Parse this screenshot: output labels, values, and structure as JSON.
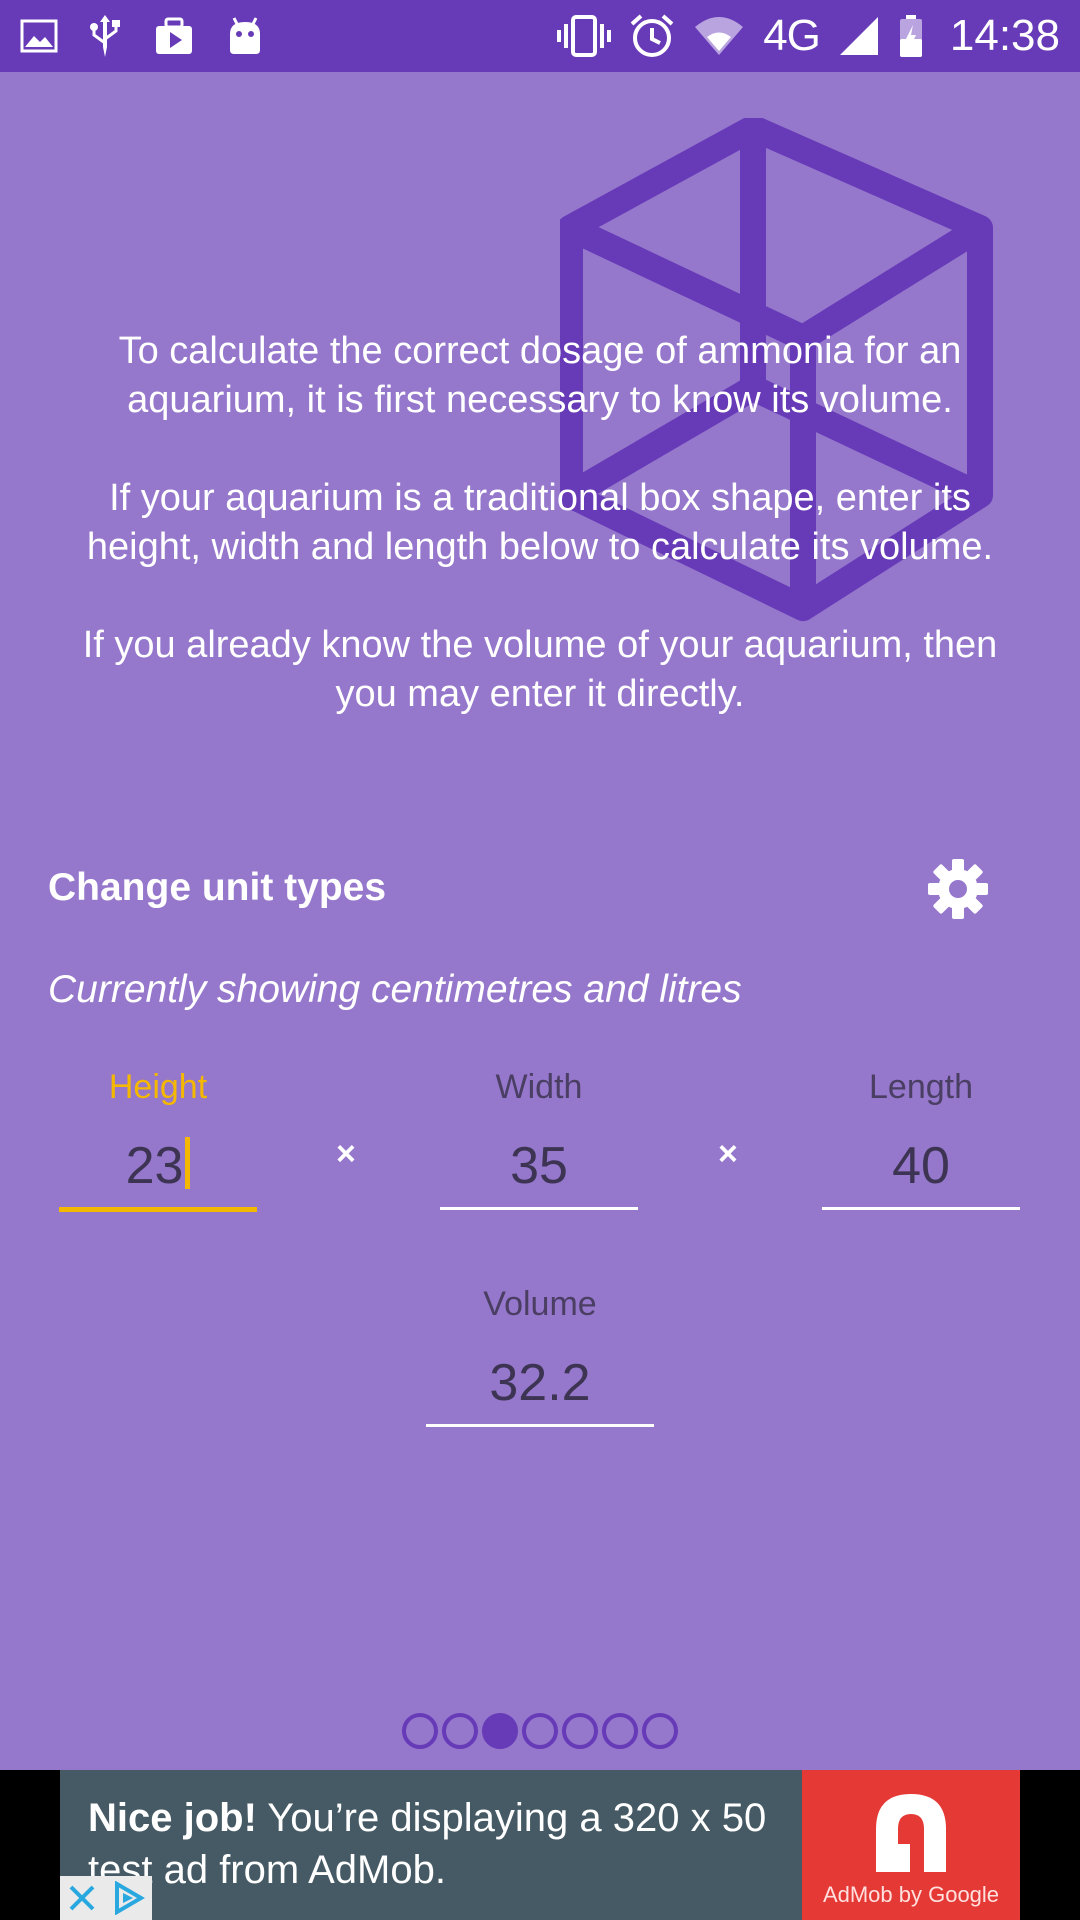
{
  "status_bar": {
    "network": "4G",
    "time": "14:38",
    "icons": [
      "image-icon",
      "usb-icon",
      "media-icon",
      "android-icon",
      "vibrate-icon",
      "alarm-icon",
      "wifi-icon",
      "signal-icon",
      "battery-icon"
    ]
  },
  "intro": {
    "paragraph1": "To calculate the correct dosage of ammonia for an aquarium, it is first necessary to know its volume.",
    "paragraph2": "If your aquarium is a traditional box shape, enter its height, width and length below to calculate its volume.",
    "paragraph3": "If you already know the volume of your aquarium, then you may enter it directly."
  },
  "units": {
    "title": "Change unit types",
    "description": "Currently showing centimetres and litres"
  },
  "dimensions": {
    "height_label": "Height",
    "height_value": "23",
    "width_label": "Width",
    "width_value": "35",
    "length_label": "Length",
    "length_value": "40",
    "times_symbol": "×"
  },
  "volume": {
    "label": "Volume",
    "value": "32.2"
  },
  "pager": {
    "total": 7,
    "current": 3
  },
  "ad": {
    "bold": "Nice job!",
    "text": " You’re displaying a 320 x 50 test ad from AdMob.",
    "brand": "AdMob by Google"
  },
  "colors": {
    "background": "#9577cc",
    "primary": "#673ab7",
    "accent": "#f5b800"
  }
}
